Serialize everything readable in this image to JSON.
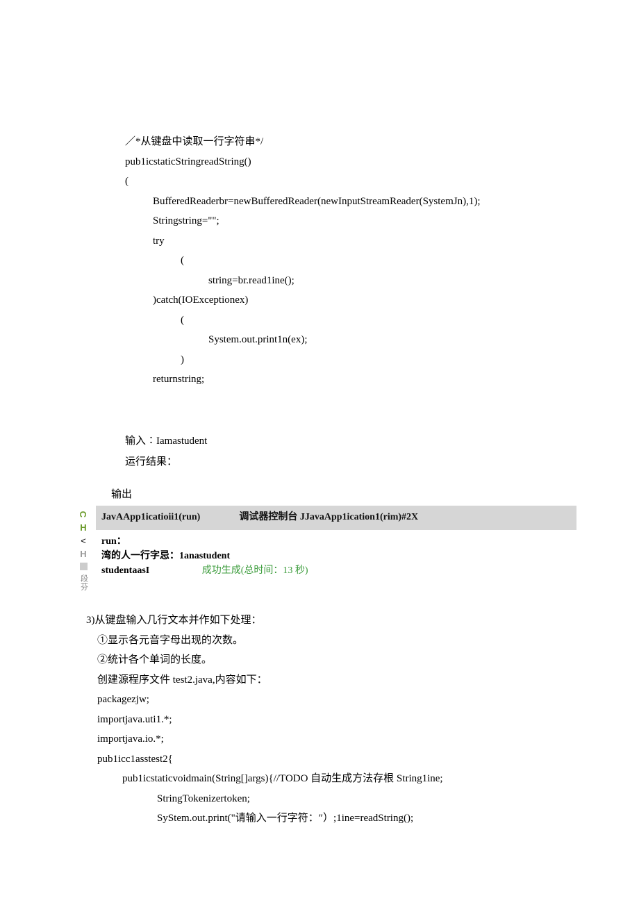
{
  "code": {
    "c1": "／*从键盘中读取一行字符串*/",
    "c2": "pub1icstaticStringreadString()",
    "c3": "(",
    "c4": "BufferedReaderbr=newBufferedReader(newInputStreamReader(SystemJn),1);",
    "c5": "Stringstring=\"\";",
    "c6": "try",
    "c7": "(",
    "c8": "string=br.read1ine();",
    "c9": ")catch(IOExceptionex)",
    "c10": "(",
    "c11": "System.out.print1n(ex);",
    "c12": ")",
    "c13": "returnstring;"
  },
  "input": {
    "line1": "输入∶Iamastudent",
    "line2": "运行结果："
  },
  "output": {
    "title": "输出",
    "tab_left": "JavAApp1icatioii1(run)",
    "tab_right": "调试器控制台 JJavaApp1ication1(rim)#2X",
    "run_label": "run：",
    "line1": "湾的人一行字忌：1anastudent",
    "line2": "studentaasI",
    "success": "成功生成(总时间：13 秒)",
    "gutter_seg": "段芬"
  },
  "section3": {
    "heading": "3)从键盘输入几行文本并作如下处理：",
    "l1": "①显示各元音字母出现的次数。",
    "l2": "②统计各个单词的长度。",
    "l3": " 创建源程序文件 test2.java,内容如下：",
    "l4": "packagezjw;",
    "l5": "importjava.uti1.*;",
    "l6": "importjava.io.*;",
    "l7": "pub1icc1asstest2{",
    "l8": "pub1icstaticvoidmain(String[]args){//TODO 自动生成方法存根 String1ine;",
    "l9": "StringTokenizertoken;",
    "l10": "SyStem.out.print(\"请输入一行字符：″）;1ine=readString();"
  }
}
